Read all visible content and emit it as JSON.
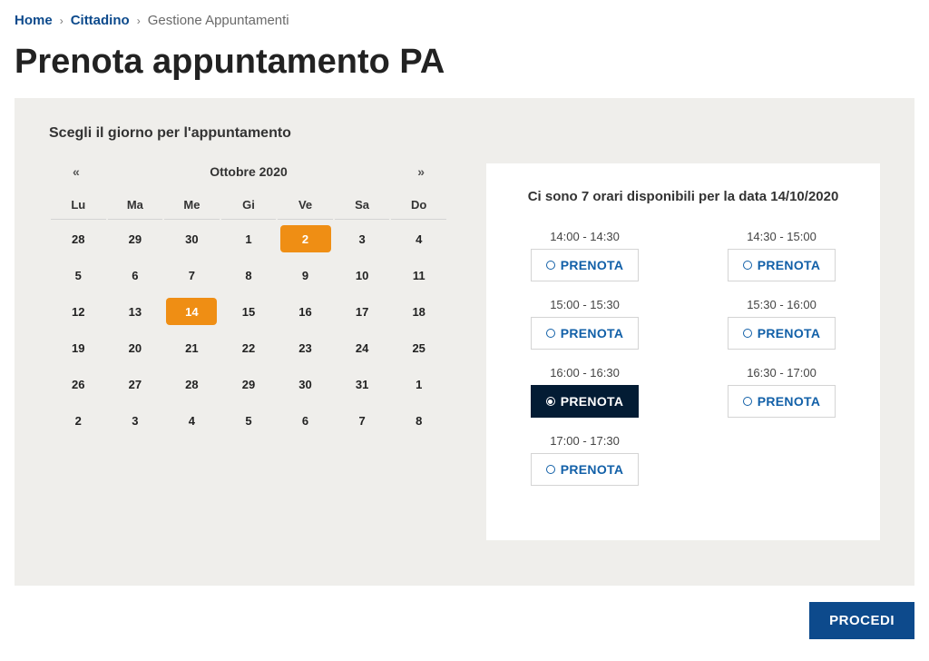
{
  "breadcrumb": {
    "home": "Home",
    "level1": "Cittadino",
    "current": "Gestione Appuntamenti"
  },
  "page_title": "Prenota appuntamento PA",
  "calendar_section_title": "Scegli il giorno per l'appuntamento",
  "calendar": {
    "prev": "«",
    "next": "»",
    "month_label": "Ottobre 2020",
    "weekdays": [
      "Lu",
      "Ma",
      "Me",
      "Gi",
      "Ve",
      "Sa",
      "Do"
    ],
    "weeks": [
      [
        {
          "d": "28",
          "state": "outside"
        },
        {
          "d": "29",
          "state": "outside"
        },
        {
          "d": "30",
          "state": "outside"
        },
        {
          "d": "1",
          "state": "disabled"
        },
        {
          "d": "2",
          "state": "marked"
        },
        {
          "d": "3",
          "state": "disabled"
        },
        {
          "d": "4",
          "state": "disabled"
        }
      ],
      [
        {
          "d": "5",
          "state": "normal"
        },
        {
          "d": "6",
          "state": "normal"
        },
        {
          "d": "7",
          "state": "normal"
        },
        {
          "d": "8",
          "state": "normal"
        },
        {
          "d": "9",
          "state": "normal"
        },
        {
          "d": "10",
          "state": "disabled"
        },
        {
          "d": "11",
          "state": "disabled"
        }
      ],
      [
        {
          "d": "12",
          "state": "normal"
        },
        {
          "d": "13",
          "state": "normal"
        },
        {
          "d": "14",
          "state": "selected"
        },
        {
          "d": "15",
          "state": "disabled"
        },
        {
          "d": "16",
          "state": "disabled"
        },
        {
          "d": "17",
          "state": "disabled"
        },
        {
          "d": "18",
          "state": "disabled"
        }
      ],
      [
        {
          "d": "19",
          "state": "normal"
        },
        {
          "d": "20",
          "state": "normal"
        },
        {
          "d": "21",
          "state": "normal"
        },
        {
          "d": "22",
          "state": "disabled"
        },
        {
          "d": "23",
          "state": "disabled"
        },
        {
          "d": "24",
          "state": "disabled"
        },
        {
          "d": "25",
          "state": "disabled"
        }
      ],
      [
        {
          "d": "26",
          "state": "normal"
        },
        {
          "d": "27",
          "state": "normal"
        },
        {
          "d": "28",
          "state": "normal"
        },
        {
          "d": "29",
          "state": "disabled"
        },
        {
          "d": "30",
          "state": "disabled"
        },
        {
          "d": "31",
          "state": "disabled"
        },
        {
          "d": "1",
          "state": "outside"
        }
      ],
      [
        {
          "d": "2",
          "state": "outside"
        },
        {
          "d": "3",
          "state": "outside"
        },
        {
          "d": "4",
          "state": "outside"
        },
        {
          "d": "5",
          "state": "outside"
        },
        {
          "d": "6",
          "state": "outside"
        },
        {
          "d": "7",
          "state": "outside"
        },
        {
          "d": "8",
          "state": "outside"
        }
      ]
    ]
  },
  "slots": {
    "title": "Ci sono 7 orari disponibili per la data 14/10/2020",
    "button_label": "PRENOTA",
    "items": [
      {
        "time": "14:00 - 14:30",
        "selected": false
      },
      {
        "time": "14:30 - 15:00",
        "selected": false
      },
      {
        "time": "15:00 - 15:30",
        "selected": false
      },
      {
        "time": "15:30 - 16:00",
        "selected": false
      },
      {
        "time": "16:00 - 16:30",
        "selected": true
      },
      {
        "time": "16:30 - 17:00",
        "selected": false
      },
      {
        "time": "17:00 - 17:30",
        "selected": false
      }
    ]
  },
  "proceed_label": "PROCEDI"
}
